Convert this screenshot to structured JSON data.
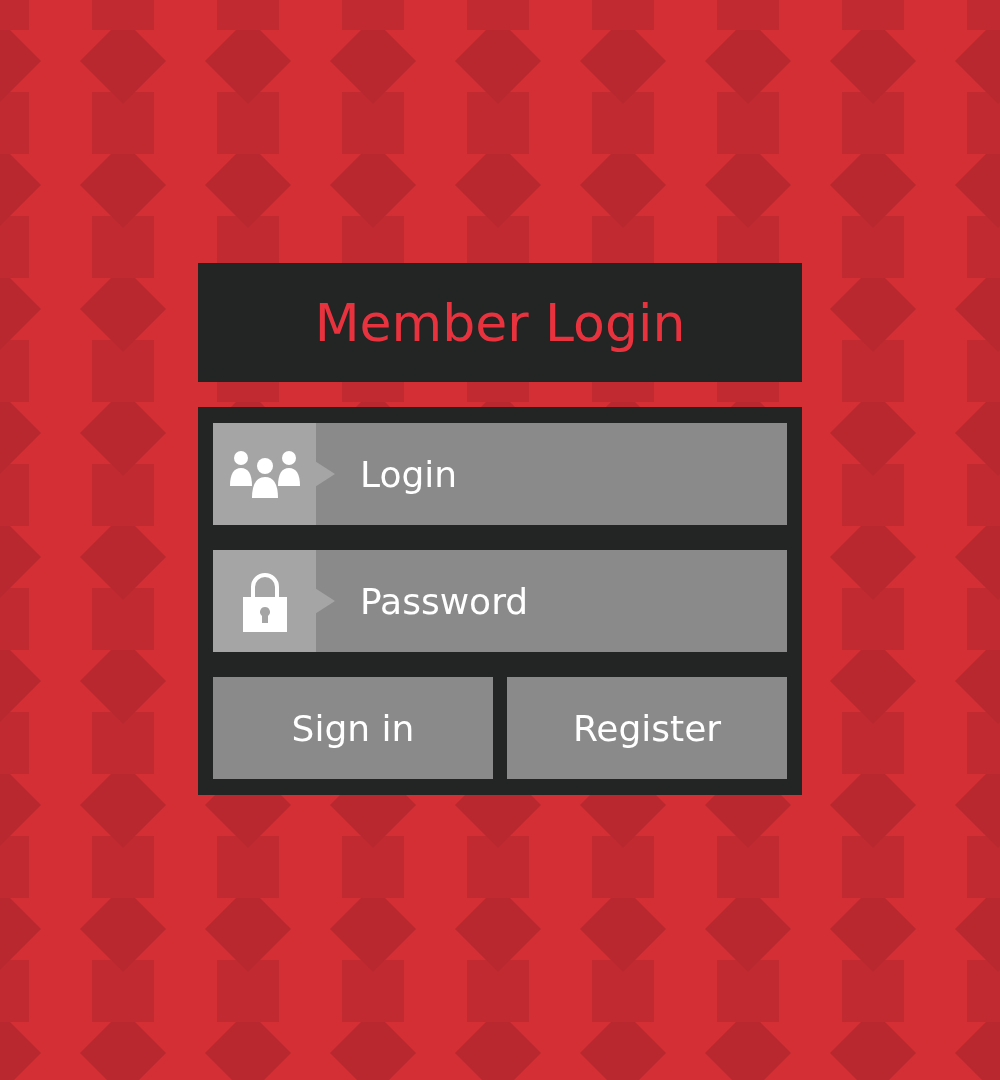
{
  "title": "Member Login",
  "fields": [
    {
      "kind": "users",
      "placeholder": "Login"
    },
    {
      "kind": "lock",
      "placeholder": "Password"
    }
  ],
  "buttons": [
    "Sign in",
    "Register"
  ]
}
